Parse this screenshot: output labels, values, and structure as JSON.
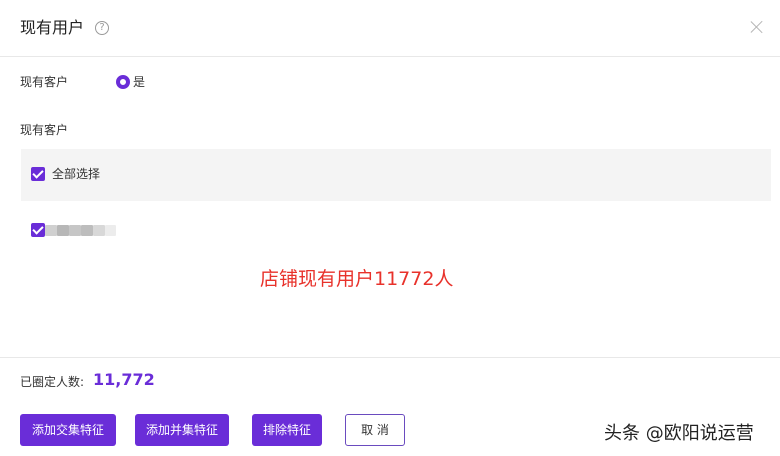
{
  "dialog": {
    "title": "现有用户",
    "help_icon_glyph": "?"
  },
  "form": {
    "existing_customer_label": "现有客户",
    "radio_option_label": "是",
    "customer_list_label": "现有客户",
    "select_all_label": "全部选择"
  },
  "annotation": {
    "text": "店铺现有用户11772人",
    "color": "#e8322b"
  },
  "footer": {
    "count_label": "已圈定人数:",
    "count_value": "11,772",
    "buttons": {
      "add_intersection": "添加交集特征",
      "add_union": "添加并集特征",
      "exclude": "排除特征",
      "cancel": "取 消"
    }
  },
  "watermark": {
    "text": "头条 @欧阳说运营"
  },
  "colors": {
    "accent": "#6a2dd8",
    "border": "#e8e8e8",
    "panel_bg": "#f4f4f4"
  }
}
